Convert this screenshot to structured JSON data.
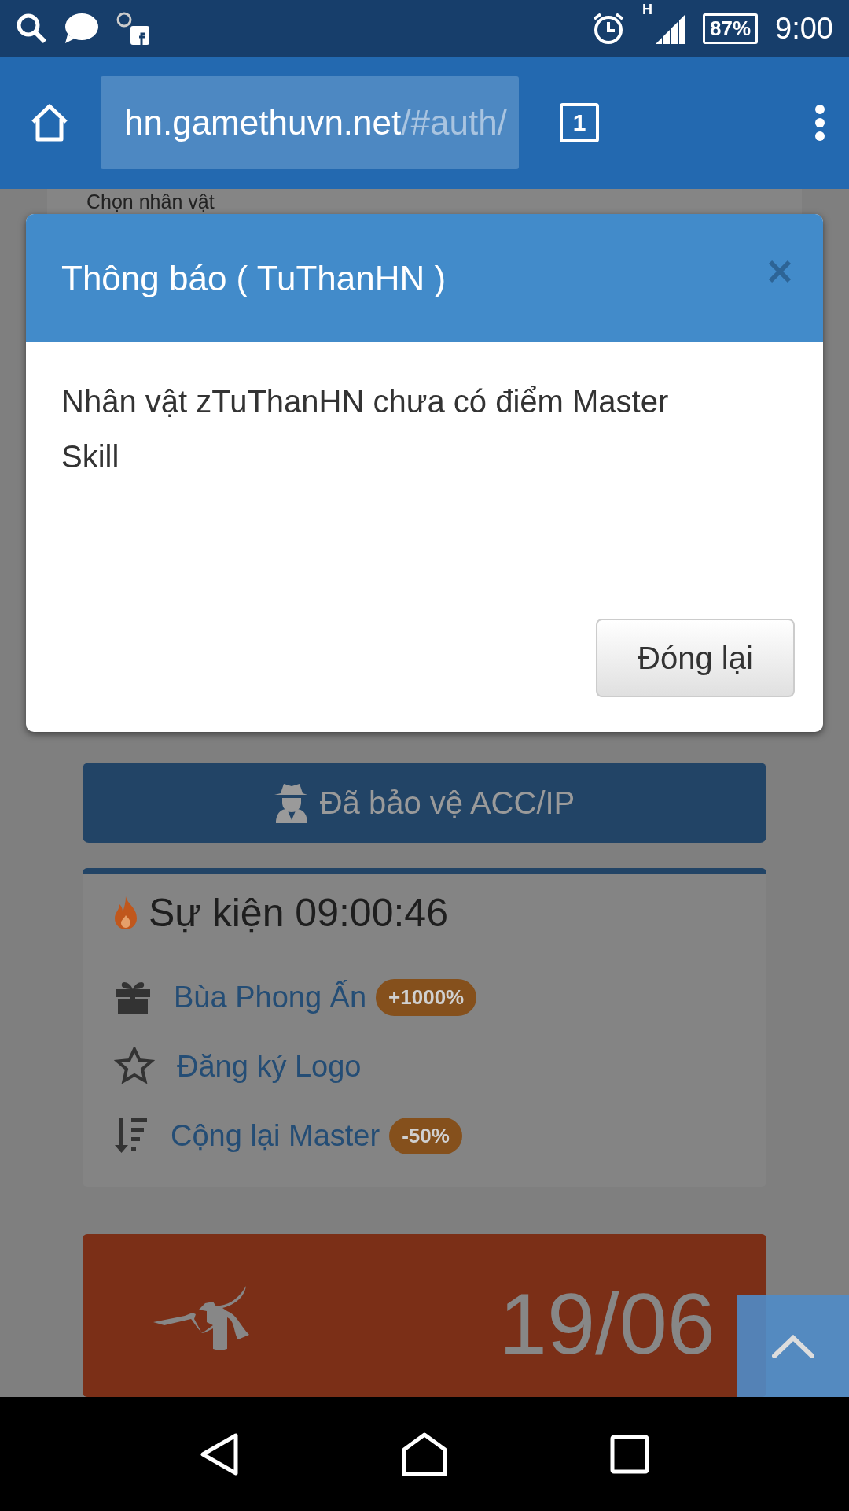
{
  "status_bar": {
    "network": "H",
    "battery": "87%",
    "time": "9:00"
  },
  "browser": {
    "url_host": "hn.gamethuvn.net",
    "url_path": "/#auth/",
    "tab_count": "1"
  },
  "page": {
    "character_card": {
      "title": "Chọn nhân vật"
    },
    "protect_button": "Đã bảo vệ ACC/IP",
    "events": {
      "title": "Sự kiện 09:00:46",
      "items": [
        {
          "kind": "gift",
          "label": "Bùa Phong Ấn",
          "badge": "+1000%"
        },
        {
          "kind": "star",
          "label": "Đăng ký Logo"
        },
        {
          "kind": "sort",
          "label": "Cộng lại Master",
          "badge": "-50%"
        }
      ]
    },
    "banner": {
      "date": "19/06"
    }
  },
  "dialog": {
    "title": "Thông báo ( TuThanHN )",
    "message": "Nhân vật zTuThanHN chưa có điểm Master Skill",
    "close_button": "Đóng lại"
  }
}
